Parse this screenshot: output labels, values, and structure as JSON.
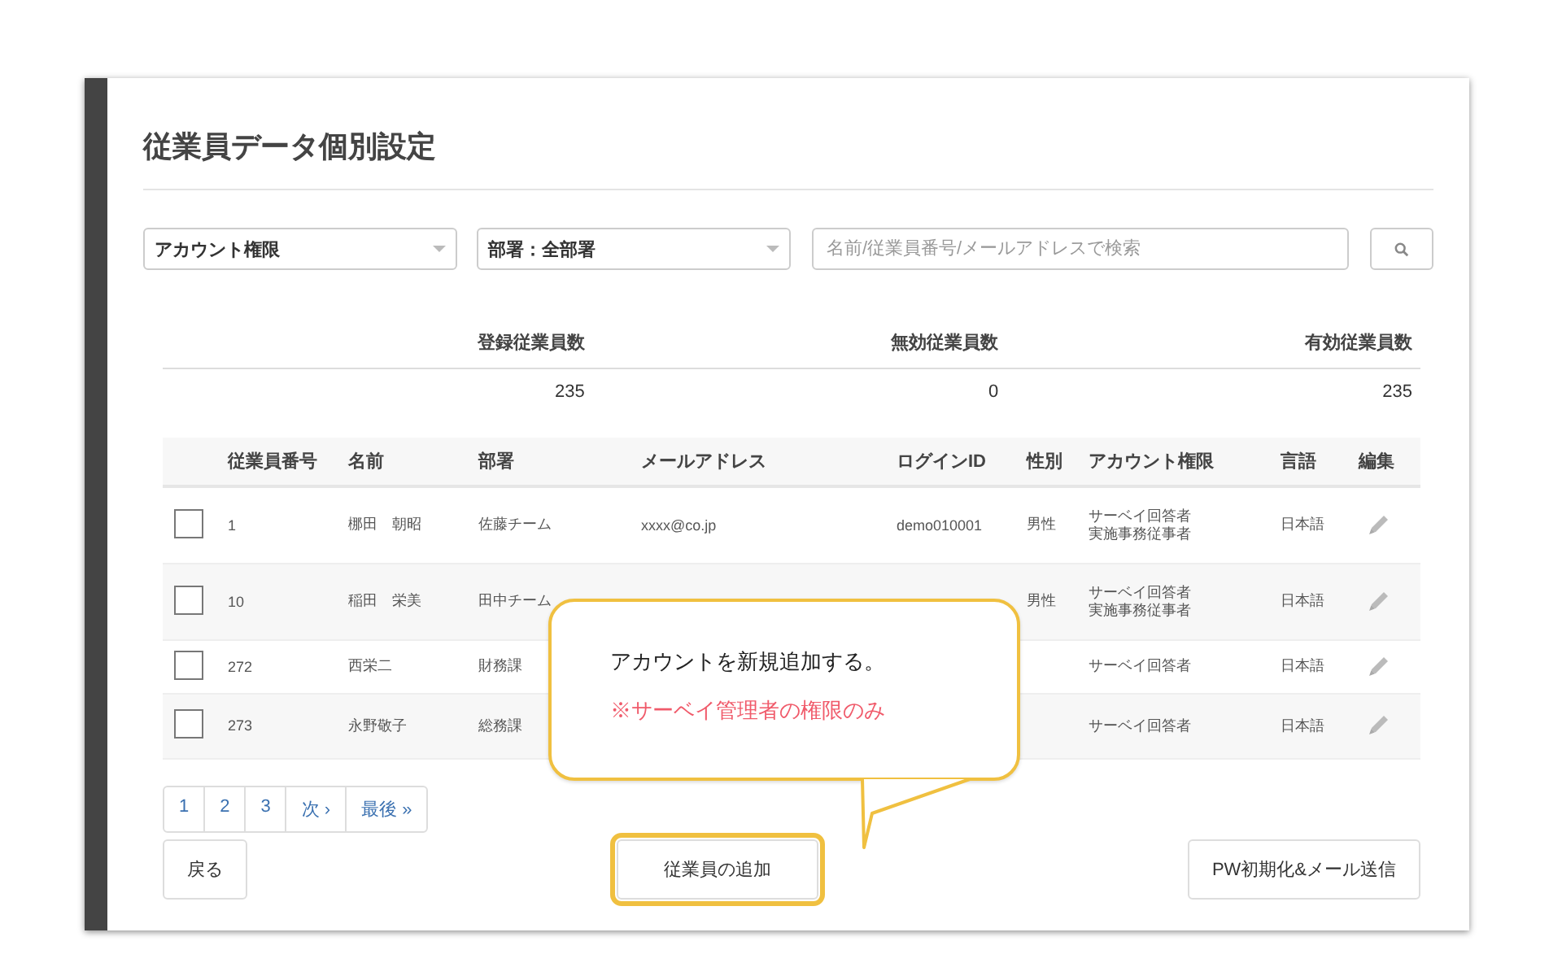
{
  "title": "従業員データ個別設定",
  "filters": {
    "account_role": "アカウント権限",
    "department": "部署：全部署",
    "search": {
      "placeholder": "名前/従業員番号/メールアドレスで検索"
    }
  },
  "stats": [
    {
      "label": "登録従業員数",
      "value": "235"
    },
    {
      "label": "無効従業員数",
      "value": "0"
    },
    {
      "label": "有効従業員数",
      "value": "235"
    }
  ],
  "table": {
    "columns": [
      "従業員番号",
      "名前",
      "部署",
      "メールアドレス",
      "ログインID",
      "性別",
      "アカウント権限",
      "言語",
      "編集"
    ],
    "rows": [
      {
        "checked": false,
        "id": "1",
        "name": "梛田　朝昭",
        "department": "佐藤チーム",
        "email": "xxxx@co.jp",
        "login_id": "demo010001",
        "gender": "男性",
        "roles": [
          "サーベイ回答者",
          "実施事務従事者"
        ],
        "language": "日本語"
      },
      {
        "checked": false,
        "id": "10",
        "name": "稲田　栄美",
        "department": "田中チーム",
        "gender": "男性",
        "roles": [
          "サーベイ回答者",
          "実施事務従事者"
        ],
        "language": "日本語"
      },
      {
        "checked": false,
        "id": "272",
        "name": "西栄二",
        "department": "財務課",
        "roles": [
          "サーベイ回答者"
        ],
        "language": "日本語"
      },
      {
        "checked": false,
        "id": "273",
        "name": "永野敬子",
        "department": "総務課",
        "roles": [
          "サーベイ回答者"
        ],
        "language": "日本語"
      }
    ]
  },
  "pagination": [
    "1",
    "2",
    "3",
    "次 ›",
    "最後 »"
  ],
  "buttons": {
    "back": "戻る",
    "add": {
      "label": "従業員の追加",
      "highlighted": true
    },
    "reset": "PW初期化&メール送信"
  },
  "callout": {
    "text": "アカウントを新規追加する。",
    "note": "※サーベイ管理者の権限のみ"
  }
}
